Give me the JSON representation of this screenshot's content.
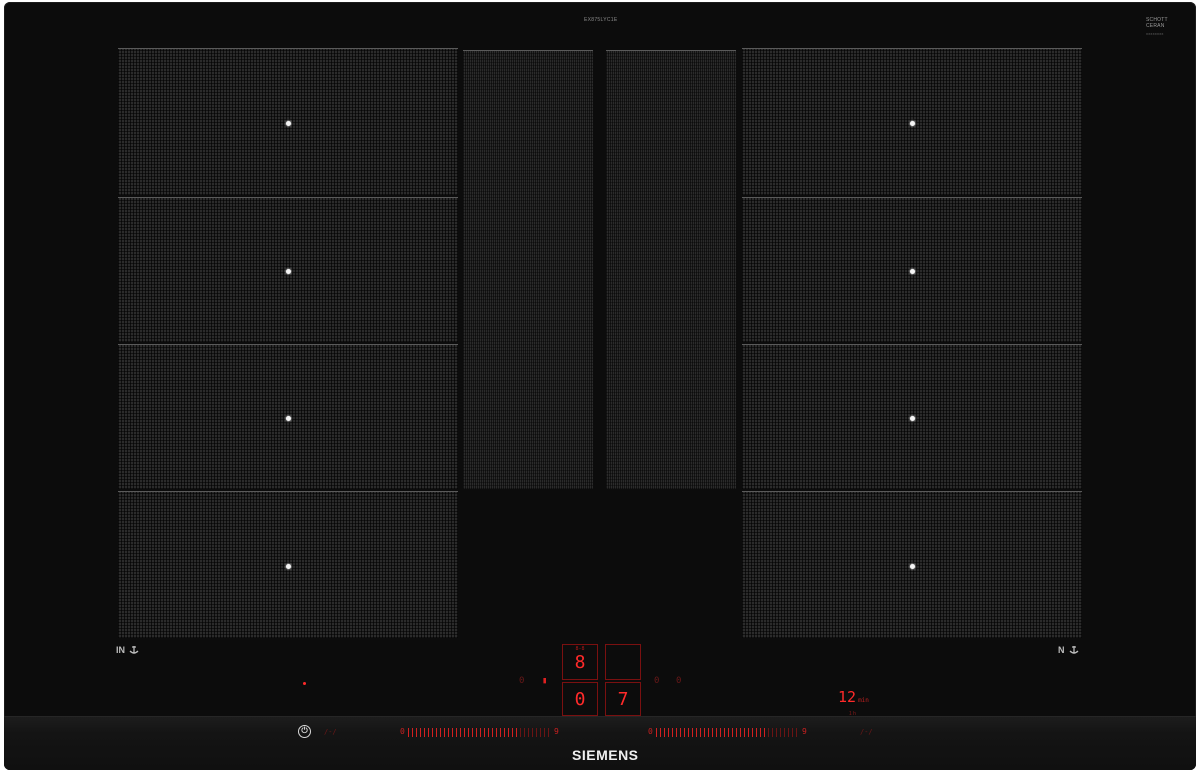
{
  "header": {
    "model_code": "EX875LYC1E",
    "glass_brand_line1": "SCHOTT",
    "glass_brand_line2": "CERAN",
    "glass_code": "XXXXXXXX"
  },
  "zones": {
    "left_column": [
      "left-zone-1",
      "left-zone-2",
      "left-zone-3",
      "left-zone-4"
    ],
    "right_column": [
      "right-zone-1",
      "right-zone-2",
      "right-zone-3",
      "right-zone-4"
    ]
  },
  "side_marks": {
    "left_label": "IN",
    "right_label": "N"
  },
  "display": {
    "main_digit": "8",
    "main_digit_top": "8-8",
    "second_digit": "0",
    "third_digit": "7",
    "left_button": "0",
    "right_button": "0",
    "left_led": "▮",
    "right_led": "0"
  },
  "timer": {
    "value": "12",
    "unit": "min",
    "sub": "1 h"
  },
  "controls": {
    "power_symbol": "⏻",
    "left_slider_start": "0",
    "left_slider_end": "9",
    "right_slider_start": "0",
    "right_slider_end": "9",
    "left_small": "/-/",
    "right_small": "/-/"
  },
  "brand": "SIEMENS",
  "colors": {
    "glass": "#0c0c0c",
    "zone": "#2b2b2b",
    "display_red": "#ff2a2a",
    "brand_white": "#f0f0f0"
  }
}
